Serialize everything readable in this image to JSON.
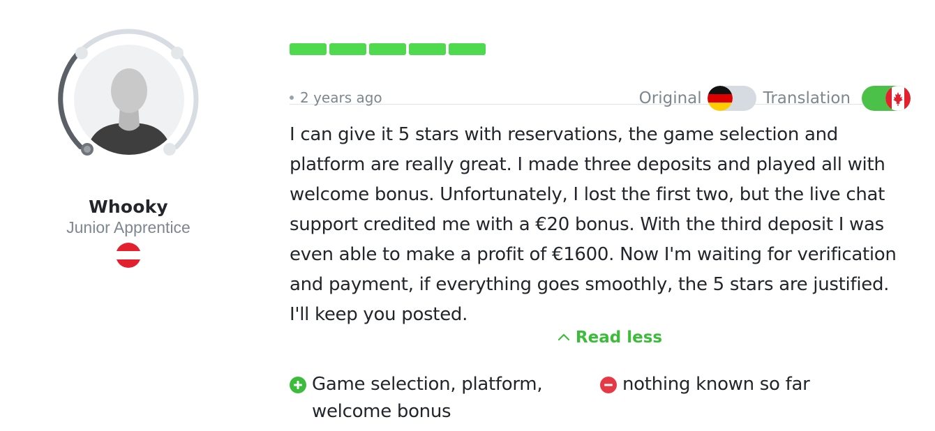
{
  "user": {
    "name": "Whooky",
    "rank": "Junior Apprentice",
    "country_flag_icon": "austria-flag-icon"
  },
  "review": {
    "rating_segments_filled": 5,
    "rating_segments_total": 5,
    "rating_color": "#4ed94e",
    "date": "2 years ago",
    "toggle_original_label": "Original",
    "toggle_original_flag_icon": "germany-flag-icon",
    "toggle_original_on": false,
    "toggle_translation_label": "Translation",
    "toggle_translation_flag_icon": "canada-flag-icon",
    "toggle_translation_on": true,
    "text": "I can give it 5 stars with reservations, the game selection and platform are really great. I made three deposits and played all with welcome bonus. Unfortunately, I lost the first two, but the live chat support credited me with a €20 bonus. With the third deposit I was even able to make a profit of €1600. Now I'm waiting for verification and payment, if everything goes smoothly, the 5 stars are justified. I'll keep you posted.",
    "read_less_label": "Read less",
    "pros": "Game selection, platform, welcome bonus",
    "cons": "nothing known so far"
  },
  "colors": {
    "accent_green": "#3dbb3a",
    "toggle_on": "#4cc14a",
    "toggle_off": "#d5dbe0",
    "con_red": "#e53945",
    "muted_text": "#7d8790"
  }
}
